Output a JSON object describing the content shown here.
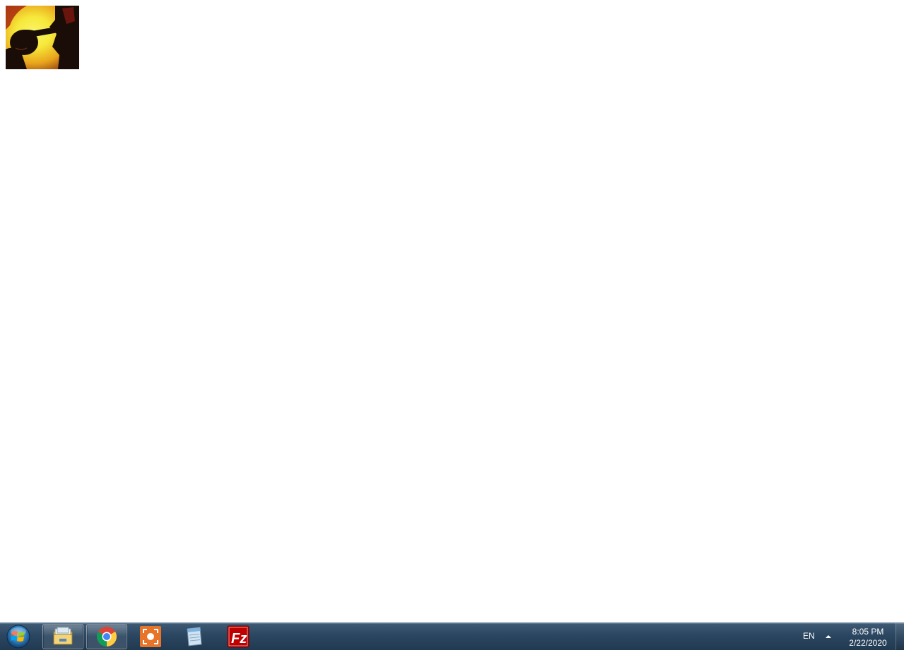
{
  "desktop": {
    "thumbnail": {
      "icon": "anime-silhouette-thumbnail",
      "colors": {
        "sun": "#f6e83a",
        "glow": "#e9a41c",
        "shadow": "#1a0d08",
        "accent": "#8b1a10"
      }
    }
  },
  "taskbar": {
    "start": {
      "icon": "windows-start-orb-icon"
    },
    "buttons": [
      {
        "name": "file-explorer",
        "icon": "folder-library-icon",
        "state": "active"
      },
      {
        "name": "chrome",
        "icon": "chrome-icon",
        "state": "active"
      },
      {
        "name": "screen-capture",
        "icon": "screen-capture-icon",
        "state": "pinned"
      },
      {
        "name": "notepad",
        "icon": "notepad-icon",
        "state": "pinned"
      },
      {
        "name": "filezilla",
        "icon": "filezilla-icon",
        "state": "pinned"
      }
    ],
    "tray": {
      "language": "EN",
      "time": "8:05 PM",
      "date": "2/22/2020"
    },
    "colors": {
      "bar_top": "#3e5a74",
      "bar_bottom": "#213a52",
      "filezilla_red": "#bf0000",
      "capture_orange": "#e8742a"
    }
  }
}
